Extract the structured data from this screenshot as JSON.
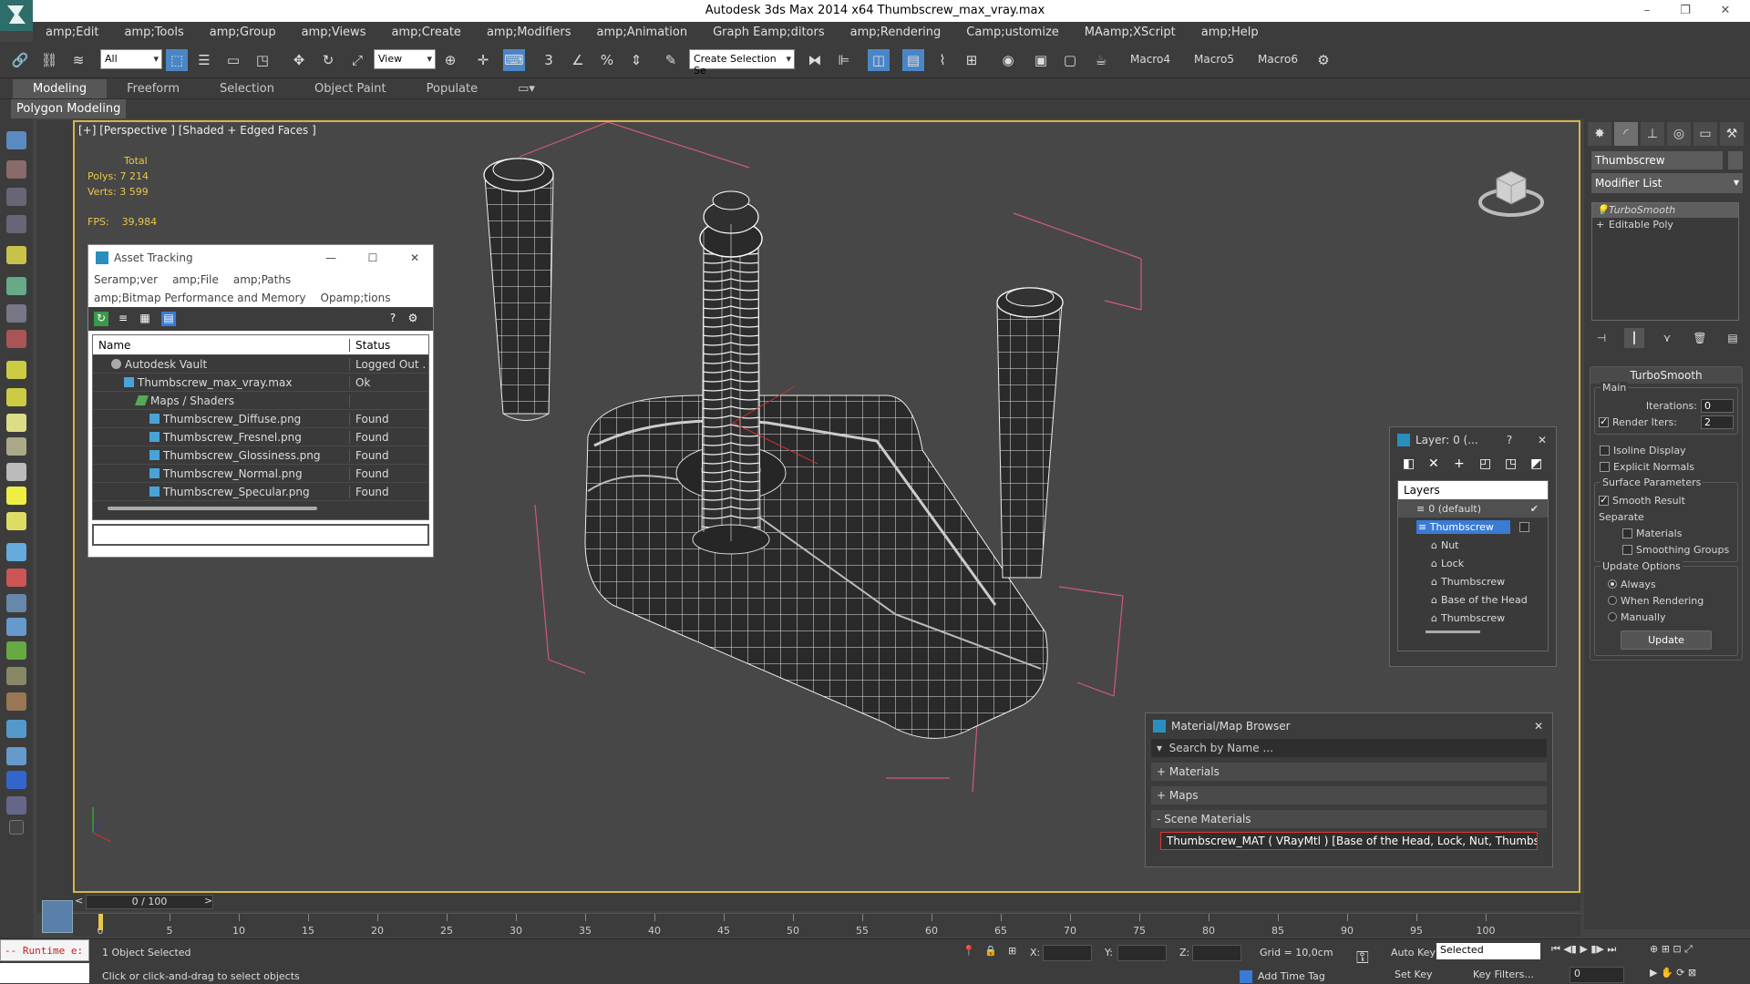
{
  "window": {
    "title": "Autodesk 3ds Max  2014 x64     Thumbscrew_max_vray.max"
  },
  "menu": [
    "amp;Edit",
    "amp;Tools",
    "amp;Group",
    "amp;Views",
    "amp;Create",
    "amp;Modifiers",
    "amp;Animation",
    "Graph Eamp;ditors",
    "amp;Rendering",
    "Camp;ustomize",
    "MAamp;XScript",
    "amp;Help"
  ],
  "toolbar": {
    "filter": "All",
    "refcoord": "View",
    "selection_set": "Create Selection Se",
    "macros": [
      "Macro4",
      "Macro5",
      "Macro6"
    ]
  },
  "ribbon": {
    "tabs": [
      "Modeling",
      "Freeform",
      "Selection",
      "Object Paint",
      "Populate"
    ],
    "subpanel": "Polygon Modeling"
  },
  "viewport": {
    "label": "[+] [Perspective ] [Shaded + Edged Faces ]",
    "stats": {
      "header": "Total",
      "polys_label": "Polys:",
      "polys": "7 214",
      "verts_label": "Verts:",
      "verts": "3 599",
      "fps_label": "FPS:",
      "fps": "39,984"
    }
  },
  "command_panel": {
    "object_name": "Thumbscrew",
    "modifier_list": "Modifier List",
    "stack": [
      "TurboSmooth",
      "Editable Poly"
    ],
    "rollout_title": "TurboSmooth",
    "main_label": "Main",
    "iterations_label": "Iterations:",
    "iterations": "0",
    "render_iters_label": "Render Iters:",
    "render_iters": "2",
    "isoline": "Isoline Display",
    "explicit": "Explicit Normals",
    "surface_label": "Surface Parameters",
    "smooth_result": "Smooth Result",
    "separate_label": "Separate",
    "materials": "Materials",
    "smoothing_groups": "Smoothing Groups",
    "update_label": "Update Options",
    "always": "Always",
    "when_rendering": "When Rendering",
    "manually": "Manually",
    "update_button": "Update"
  },
  "asset_tracking": {
    "title": "Asset Tracking",
    "menu": [
      "Seramp;ver",
      "amp;File",
      "amp;Paths",
      "amp;Bitmap Performance and Memory",
      "Opamp;tions"
    ],
    "columns": [
      "Name",
      "Status"
    ],
    "rows": [
      {
        "name": "Autodesk Vault",
        "status": "Logged Out ..."
      },
      {
        "name": "Thumbscrew_max_vray.max",
        "status": "Ok"
      },
      {
        "name": "Maps / Shaders",
        "status": ""
      },
      {
        "name": "Thumbscrew_Diffuse.png",
        "status": "Found"
      },
      {
        "name": "Thumbscrew_Fresnel.png",
        "status": "Found"
      },
      {
        "name": "Thumbscrew_Glossiness.png",
        "status": "Found"
      },
      {
        "name": "Thumbscrew_Normal.png",
        "status": "Found"
      },
      {
        "name": "Thumbscrew_Specular.png",
        "status": "Found"
      }
    ]
  },
  "layer_window": {
    "title": "Layer: 0 (...",
    "help": "?",
    "header": "Layers",
    "items": [
      "0 (default)",
      "Thumbscrew",
      "Nut",
      "Lock",
      "Thumbscrew",
      "Base of the Head",
      "Thumbscrew"
    ]
  },
  "material_browser": {
    "title": "Material/Map Browser",
    "search_placeholder": "Search by Name ...",
    "groups": [
      "+ Materials",
      "+ Maps",
      "- Scene Materials"
    ],
    "item": "Thumbscrew_MAT  ( VRayMtl )  [Base of the Head, Lock, Nut, Thumbscrew]"
  },
  "timeline": {
    "frame": "0 / 100",
    "ticks": [
      "0",
      "5",
      "10",
      "15",
      "20",
      "25",
      "30",
      "35",
      "40",
      "45",
      "50",
      "55",
      "60",
      "65",
      "70",
      "75",
      "80",
      "85",
      "90",
      "95",
      "100"
    ]
  },
  "status": {
    "runtime": "-- Runtime e:",
    "objects_selected": "1 Object Selected",
    "prompt": "Click or click-and-drag to select objects",
    "x": "X:",
    "y": "Y:",
    "z": "Z:",
    "grid": "Grid = 10,0cm",
    "auto_key": "Auto Key",
    "selected": "Selected",
    "set_key": "Set Key",
    "key_filters": "Key Filters...",
    "add_time_tag": "Add Time Tag",
    "frame_field": "0"
  }
}
